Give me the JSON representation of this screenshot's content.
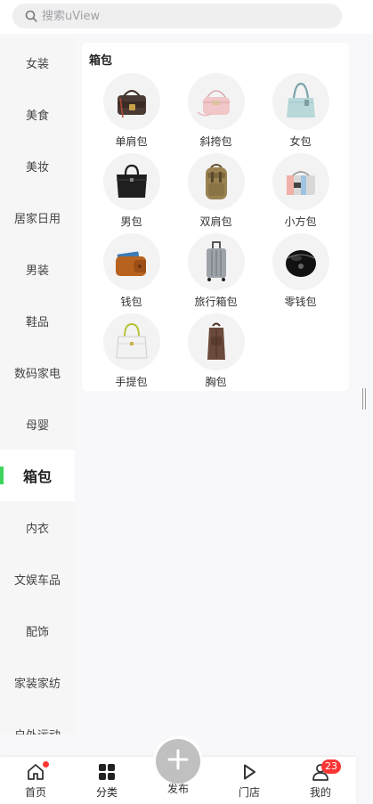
{
  "search": {
    "placeholder": "搜索uView"
  },
  "sidebar": {
    "items": [
      {
        "label": "女装"
      },
      {
        "label": "美食"
      },
      {
        "label": "美妆"
      },
      {
        "label": "居家日用"
      },
      {
        "label": "男装"
      },
      {
        "label": "鞋品"
      },
      {
        "label": "数码家电"
      },
      {
        "label": "母婴"
      },
      {
        "label": "箱包",
        "active": true
      },
      {
        "label": "内衣"
      },
      {
        "label": "文娱车品"
      },
      {
        "label": "配饰"
      },
      {
        "label": "家装家纺"
      },
      {
        "label": "户外运动"
      }
    ]
  },
  "content": {
    "title": "箱包",
    "items": [
      {
        "label": "单肩包",
        "icon": "shoulder-bag-icon"
      },
      {
        "label": "斜挎包",
        "icon": "crossbody-bag-icon"
      },
      {
        "label": "女包",
        "icon": "womens-bag-icon"
      },
      {
        "label": "男包",
        "icon": "mens-bag-icon"
      },
      {
        "label": "双肩包",
        "icon": "backpack-icon"
      },
      {
        "label": "小方包",
        "icon": "square-bag-icon"
      },
      {
        "label": "钱包",
        "icon": "wallet-icon"
      },
      {
        "label": "旅行箱包",
        "icon": "suitcase-icon"
      },
      {
        "label": "零钱包",
        "icon": "coin-purse-icon"
      },
      {
        "label": "手提包",
        "icon": "handbag-icon"
      },
      {
        "label": "胸包",
        "icon": "chest-bag-icon"
      }
    ]
  },
  "tabbar": {
    "items": [
      {
        "label": "首页",
        "icon": "home-icon"
      },
      {
        "label": "分类",
        "icon": "category-icon"
      },
      {
        "label": "发布",
        "icon": "plus-icon"
      },
      {
        "label": "门店",
        "icon": "play-icon"
      },
      {
        "label": "我的",
        "icon": "user-icon",
        "badge": "23"
      }
    ]
  },
  "colors": {
    "accent": "#3cd45b",
    "badge": "#fa3534"
  }
}
